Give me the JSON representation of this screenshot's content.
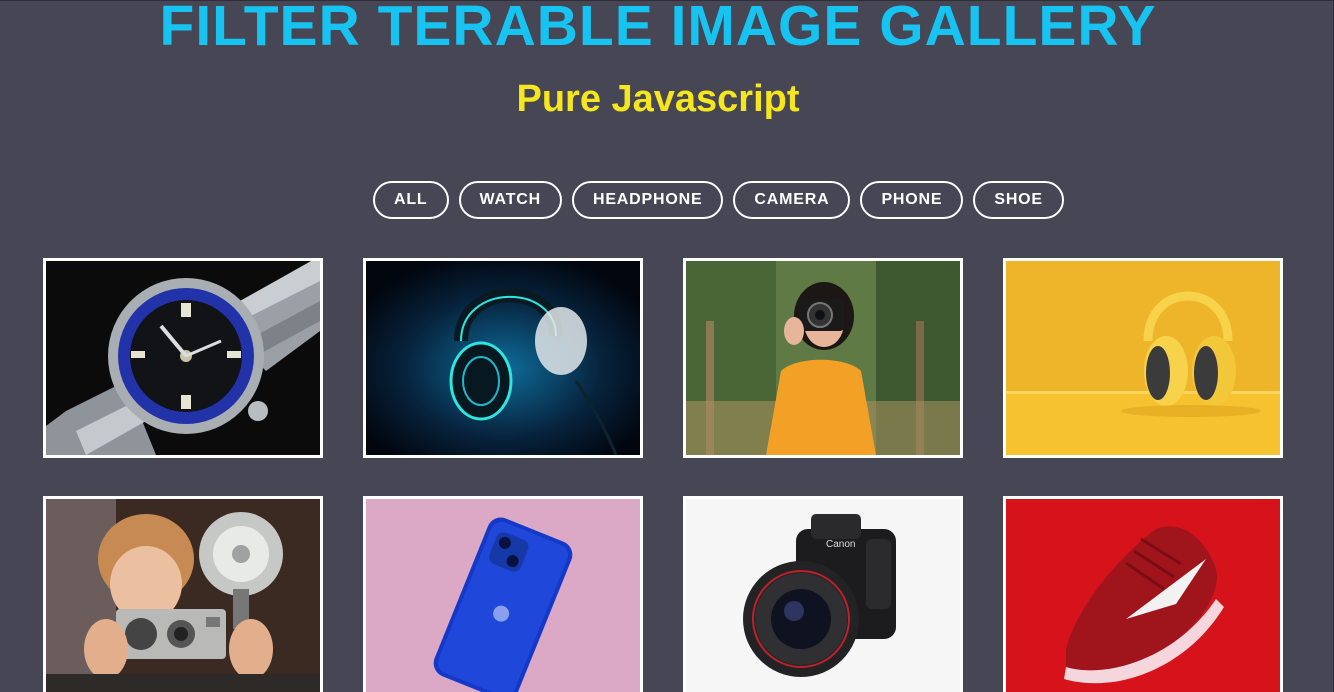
{
  "header": {
    "title": "FILTER TERABLE IMAGE GALLERY",
    "subtitle": "Pure Javascript",
    "title_color": "#17c3f0",
    "subtitle_color": "#f5e61d"
  },
  "filters": [
    {
      "label": "ALL"
    },
    {
      "label": "WATCH"
    },
    {
      "label": "HEADPHONE"
    },
    {
      "label": "CAMERA"
    },
    {
      "label": "PHONE"
    },
    {
      "label": "SHOE"
    }
  ],
  "gallery": {
    "items": [
      {
        "category": "watch",
        "image": "watch-image"
      },
      {
        "category": "headphone",
        "image": "neon-headphone-image"
      },
      {
        "category": "camera",
        "image": "photographer-image"
      },
      {
        "category": "headphone",
        "image": "yellow-headphone-image"
      },
      {
        "category": "camera",
        "image": "vintage-camera-image"
      },
      {
        "category": "phone",
        "image": "blue-phone-image"
      },
      {
        "category": "camera",
        "image": "dslr-camera-image"
      },
      {
        "category": "shoe",
        "image": "red-shoe-image"
      }
    ]
  },
  "colors": {
    "background": "#464655",
    "button_border": "#ffffff"
  }
}
